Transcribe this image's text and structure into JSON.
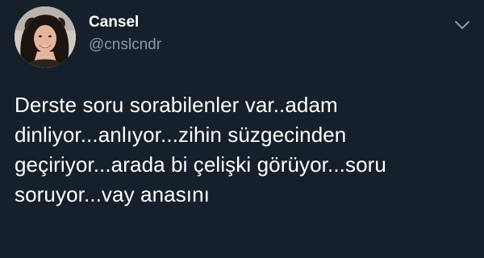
{
  "author": {
    "display_name": "Cansel",
    "handle": "@cnslcndr",
    "avatar_icon": "profile-photo"
  },
  "menu": {
    "icon": "chevron-down-icon"
  },
  "tweet": {
    "lines": [
      "Derste soru sorabilenler var..adam",
      "dinliyor...anlıyor...zihin süzgecinden",
      "geçiriyor...arada bi çelişki görüyor...soru",
      "soruyor...vay anasını"
    ]
  },
  "colors": {
    "background": "#15202b",
    "primary_text": "#ffffff",
    "secondary_text": "#8899a6"
  }
}
